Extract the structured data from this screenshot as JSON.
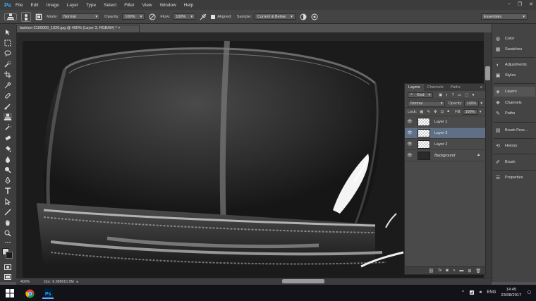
{
  "app": {
    "logo": "Ps"
  },
  "menu": [
    "File",
    "Edit",
    "Image",
    "Layer",
    "Type",
    "Select",
    "Filter",
    "View",
    "Window",
    "Help"
  ],
  "window_controls": {
    "minimize": "–",
    "restore": "❐",
    "close": "✕"
  },
  "options": {
    "mode_label": "Mode:",
    "mode_value": "Normal",
    "opacity_label": "Opacity:",
    "opacity_value": "100%",
    "flow_label": "Flow:",
    "flow_value": "100%",
    "aligned_label": "Aligned",
    "sample_label": "Sample:",
    "sample_value": "Current & Below",
    "workspace": "Essentials"
  },
  "document": {
    "tab_title": "fashion-2190060_1920.jpg @ 400% (Layer 3, RGB/8#) *",
    "tab_close": "×",
    "zoom": "400%",
    "doc_info": "Doc: 6.98M/15.5M",
    "status_arrow": "▸"
  },
  "layers_panel": {
    "tabs": [
      "Layers",
      "Channels",
      "Paths"
    ],
    "kind_label": "Kind",
    "blend_mode": "Normal",
    "opacity_label": "Opacity:",
    "opacity_value": "100%",
    "lock_label": "Lock:",
    "fill_label": "Fill:",
    "fill_value": "100%",
    "layers": [
      {
        "name": "Layer 1",
        "selected": false,
        "thumb": "transparent"
      },
      {
        "name": "Layer 3",
        "selected": true,
        "thumb": "transparent"
      },
      {
        "name": "Layer 2",
        "selected": false,
        "thumb": "transparent"
      },
      {
        "name": "Background",
        "selected": false,
        "thumb": "dark",
        "locked": true
      }
    ],
    "bottom_icons": [
      "link-icon",
      "fx-icon",
      "mask-icon",
      "adjustment-icon",
      "folder-icon",
      "new-layer-icon",
      "trash-icon"
    ]
  },
  "dock": {
    "items": [
      "Color",
      "Swatches",
      "Adjustments",
      "Styles",
      "Layers",
      "Channels",
      "Paths",
      "Brush Pres...",
      "History",
      "Brush",
      "Properties"
    ],
    "active": "Layers"
  },
  "taskbar": {
    "language": "ENG",
    "time": "14:45",
    "date": "23/08/2017",
    "tray_caret": "^"
  },
  "colors": {
    "accent_ps": "#31a8ff",
    "selected_layer": "#5f6f86",
    "taskbar": "#111318"
  }
}
